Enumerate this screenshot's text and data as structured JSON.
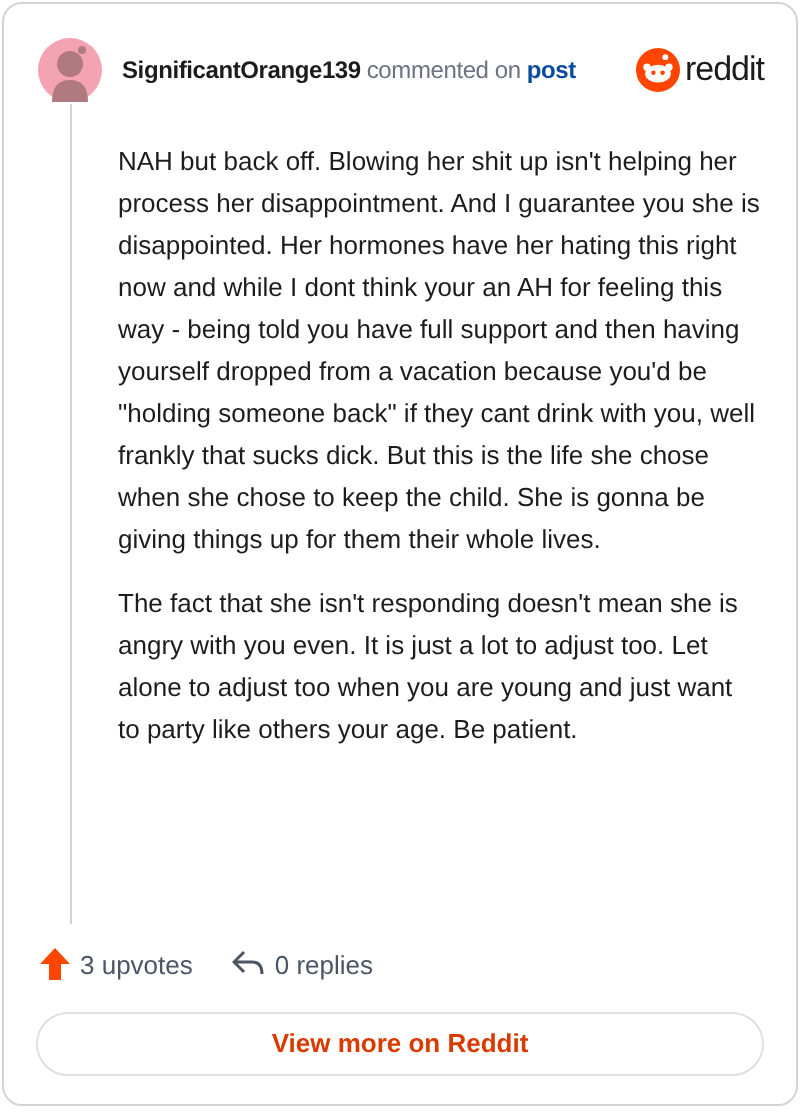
{
  "header": {
    "username": "SignificantOrange139",
    "action": "commented on",
    "link": "post",
    "logo_text": "reddit"
  },
  "paragraphs": [
    "NAH but back off. Blowing her shit up isn't helping her process her disappointment. And I guarantee you she is disappointed. Her hormones have her hating this right now and while I dont think your an AH for feeling this way - being told you have full support and then having yourself dropped from a vacation because you'd be \"holding someone back\" if they cant drink with you, well frankly that sucks dick. But this is the life she chose when she chose to keep the child. She is gonna be giving things up for them their whole lives.",
    "The fact that she isn't responding doesn't mean she is angry with you even. It is just a lot to adjust too. Let alone to adjust too when you are young and just want to party like others your age. Be patient."
  ],
  "footer": {
    "upvotes": "3 upvotes",
    "replies": "0 replies",
    "button": "View more on Reddit"
  }
}
